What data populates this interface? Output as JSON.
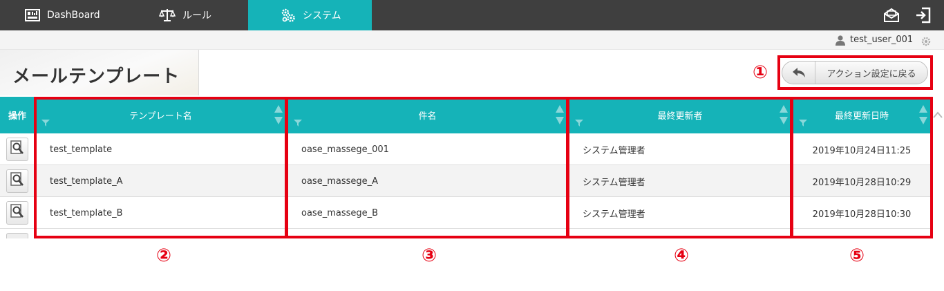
{
  "nav": {
    "tabs": [
      {
        "label": "DashBoard",
        "icon": "dashboard-icon"
      },
      {
        "label": "ルール",
        "icon": "scales-icon"
      },
      {
        "label": "システム",
        "icon": "gears-icon",
        "active": true
      }
    ],
    "right_icons": [
      "mail-icon",
      "logout-icon"
    ],
    "bg_color": "#3f3f3f",
    "active_color": "#15b3b8"
  },
  "user": {
    "name": "test_user_001"
  },
  "page": {
    "title": "メールテンプレート"
  },
  "back_button": {
    "label": "アクション設定に戻る"
  },
  "table": {
    "headers": {
      "operation": "操作",
      "template_name": "テンプレート名",
      "subject": "件名",
      "last_updated_by": "最終更新者",
      "last_updated_at": "最終更新日時"
    },
    "rows": [
      {
        "name": "test_template",
        "subject": "oase_massege_001",
        "user": "システム管理者",
        "date": "2019年10月24日11:25"
      },
      {
        "name": "test_template_A",
        "subject": "oase_massege_A",
        "user": "システム管理者",
        "date": "2019年10月28日10:29"
      },
      {
        "name": "test_template_B",
        "subject": "oase_massege_B",
        "user": "システム管理者",
        "date": "2019年10月28日10:30"
      }
    ]
  },
  "annotations": [
    "①",
    "②",
    "③",
    "④",
    "⑤"
  ]
}
